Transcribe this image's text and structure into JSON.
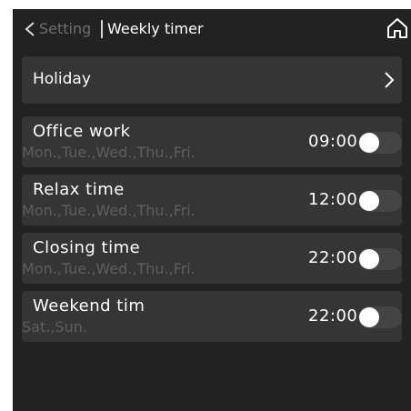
{
  "header": {
    "back_icon": "chevron-left-icon",
    "breadcrumb": "Setting",
    "title": "Weekly timer",
    "home_icon": "home-icon"
  },
  "holiday": {
    "label": "Holiday",
    "icon": "chevron-right-icon"
  },
  "timers": [
    {
      "name": "Office work",
      "days": "Mon.,Tue.,Wed.,Thu.,Fri.",
      "time": "09:00",
      "enabled": false
    },
    {
      "name": "Relax time",
      "days": "Mon.,Tue.,Wed.,Thu.,Fri.",
      "time": "12:00",
      "enabled": false
    },
    {
      "name": "Closing time",
      "days": "Mon.,Tue.,Wed.,Thu.,Fri.",
      "time": "22:00",
      "enabled": false
    },
    {
      "name": "Weekend tim",
      "days": "Sat.,Sun.",
      "time": "22:00",
      "enabled": false
    }
  ],
  "colors": {
    "background": "#222222",
    "row": "#353535",
    "text": "#ffffff",
    "muted_text": "#6e6e6e",
    "toggle_off_track": "#444444"
  }
}
